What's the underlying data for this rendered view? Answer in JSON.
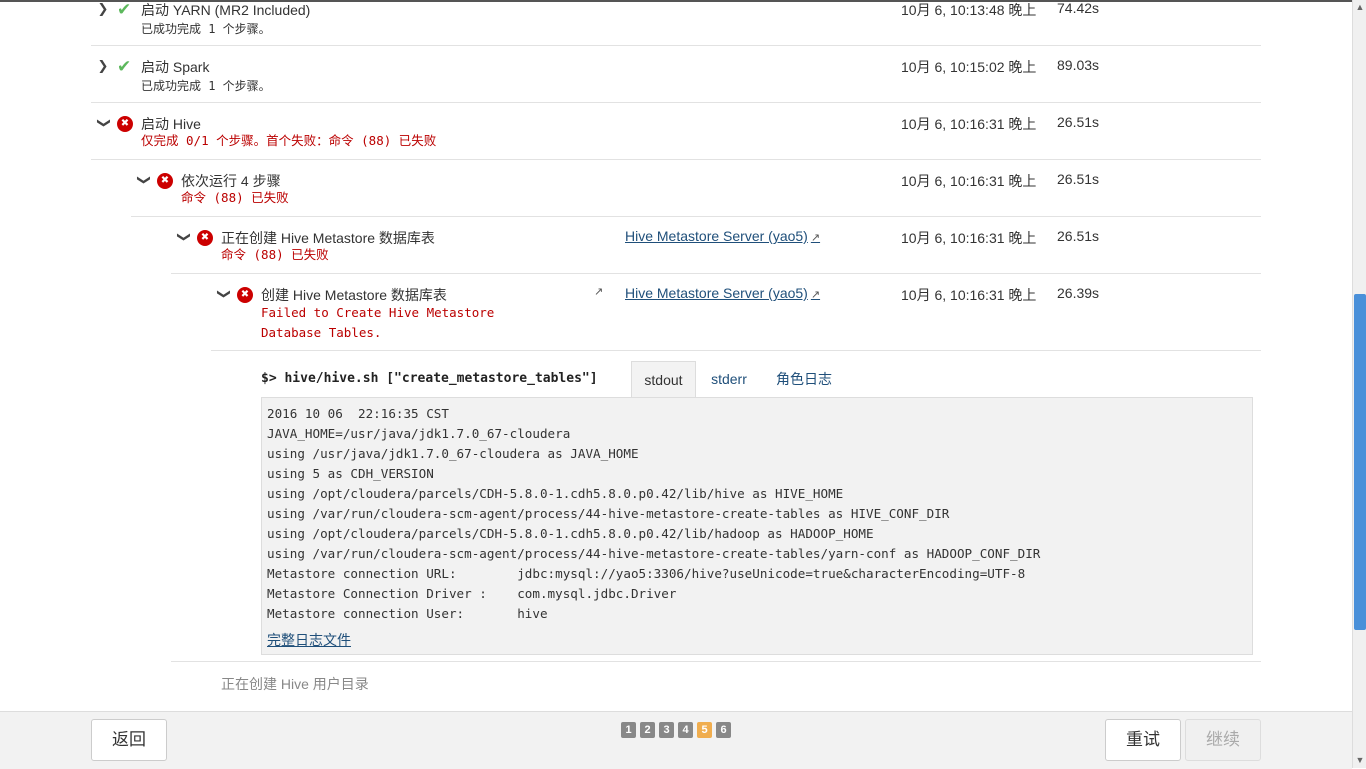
{
  "steps": [
    {
      "title": "启动 YARN (MR2 Included)",
      "subtitle": "已成功完成 1 个步骤。",
      "time": "10月 6, 10:13:48 晚上",
      "duration": "74.42s",
      "status": "ok"
    },
    {
      "title": "启动 Spark",
      "subtitle": "已成功完成 1 个步骤。",
      "time": "10月 6, 10:15:02 晚上",
      "duration": "89.03s",
      "status": "ok"
    },
    {
      "title": "启动 Hive",
      "subtitle": "仅完成 0/1 个步骤。首个失败：命令 (88) 已失败",
      "time": "10月 6, 10:16:31 晚上",
      "duration": "26.51s",
      "status": "error"
    },
    {
      "title": "依次运行 4 步骤",
      "subtitle": "命令 (88) 已失败",
      "time": "10月 6, 10:16:31 晚上",
      "duration": "26.51s",
      "status": "error"
    },
    {
      "title": "正在创建 Hive Metastore 数据库表",
      "subtitle": "命令 (88) 已失败",
      "link": "Hive Metastore Server (yao5)",
      "time": "10月 6, 10:16:31 晚上",
      "duration": "26.51s",
      "status": "error"
    },
    {
      "title": "创建 Hive Metastore 数据库表",
      "subtitle_line1": "Failed to Create Hive Metastore",
      "subtitle_line2": "Database Tables.",
      "link": "Hive Metastore Server (yao5)",
      "time": "10月 6, 10:16:31 晚上",
      "duration": "26.39s",
      "status": "error"
    }
  ],
  "command": {
    "prompt": "$>",
    "text": "hive/hive.sh [\"create_metastore_tables\"]"
  },
  "tabs": [
    {
      "label": "stdout",
      "active": true
    },
    {
      "label": "stderr",
      "active": false
    },
    {
      "label": "角色日志",
      "active": false
    }
  ],
  "log_lines": [
    "2016 10 06  22:16:35 CST",
    "JAVA_HOME=/usr/java/jdk1.7.0_67-cloudera",
    "using /usr/java/jdk1.7.0_67-cloudera as JAVA_HOME",
    "using 5 as CDH_VERSION",
    "using /opt/cloudera/parcels/CDH-5.8.0-1.cdh5.8.0.p0.42/lib/hive as HIVE_HOME",
    "using /var/run/cloudera-scm-agent/process/44-hive-metastore-create-tables as HIVE_CONF_DIR",
    "using /opt/cloudera/parcels/CDH-5.8.0-1.cdh5.8.0.p0.42/lib/hadoop as HADOOP_HOME",
    "using /var/run/cloudera-scm-agent/process/44-hive-metastore-create-tables/yarn-conf as HADOOP_CONF_DIR",
    "Metastore connection URL:        jdbc:mysql://yao5:3306/hive?useUnicode=true&characterEncoding=UTF-8",
    "Metastore Connection Driver :    com.mysql.jdbc.Driver",
    "Metastore connection User:       hive"
  ],
  "full_log_link": "完整日志文件",
  "next_step": "正在创建 Hive 用户目录",
  "footer": {
    "back_label": "返回",
    "retry_label": "重试",
    "continue_label": "继续",
    "pages": [
      "1",
      "2",
      "3",
      "4",
      "5",
      "6"
    ],
    "active_page": "5"
  },
  "colors": {
    "error": "#cc0000",
    "success": "#5cb85c",
    "link": "#1f4f7a",
    "active_page": "#f0ad4e"
  }
}
